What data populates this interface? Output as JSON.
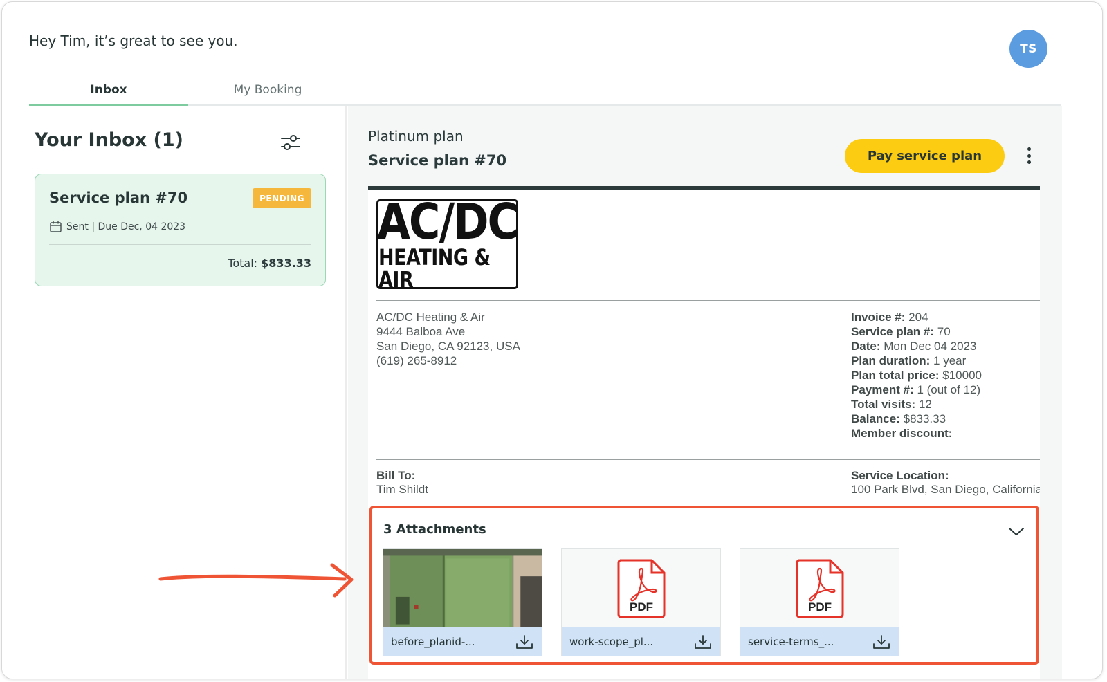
{
  "header": {
    "greeting": "Hey Tim, it’s great to see you.",
    "avatar_initials": "TS",
    "avatar_color": "#5b9be0"
  },
  "tabs": [
    {
      "label": "Inbox",
      "active": true
    },
    {
      "label": "My Booking",
      "active": false
    }
  ],
  "inbox": {
    "title": "Your Inbox (1)",
    "filter_icon": "sliders-icon",
    "cards": [
      {
        "title": "Service plan #70",
        "badge": "PENDING",
        "meta": "Sent | Due Dec, 04 2023",
        "total_label": "Total:",
        "total_value": "$833.33"
      }
    ]
  },
  "plan": {
    "name": "Platinum plan",
    "title": "Service plan #70",
    "pay_button": "Pay service plan",
    "accent_color": "#fccc12"
  },
  "invoice_doc": {
    "logo_line1": "AC/DC",
    "logo_line2": "HEATING & AIR",
    "company_lines": [
      "AC/DC Heating & Air",
      "9444 Balboa Ave",
      "San Diego, CA 92123, USA",
      "(619) 265-8912"
    ],
    "details": [
      {
        "label": "Invoice #:",
        "value": "204"
      },
      {
        "label": "Service plan #:",
        "value": "70"
      },
      {
        "label": "Date:",
        "value": "Mon Dec 04 2023"
      },
      {
        "label": "Plan duration:",
        "value": "1 year"
      },
      {
        "label": "Plan total price:",
        "value": "$10000"
      },
      {
        "label": "Payment #:",
        "value": "1 (out of 12)"
      },
      {
        "label": "Total visits:",
        "value": "12"
      },
      {
        "label": "Balance:",
        "value": "$833.33"
      },
      {
        "label": "Member discount:",
        "value": ""
      }
    ],
    "bill_to_label": "Bill To:",
    "bill_to_name": "Tim Shildt",
    "service_location_label": "Service Location:",
    "service_location_value": "100 Park Blvd, San Diego, California"
  },
  "attachments": {
    "title": "3 Attachments",
    "highlight_color": "#ef5535",
    "items": [
      {
        "name": "before_planid-...",
        "type": "image"
      },
      {
        "name": "work-scope_pl...",
        "type": "pdf",
        "icon_text": "PDF"
      },
      {
        "name": "service-terms_...",
        "type": "pdf",
        "icon_text": "PDF"
      }
    ]
  }
}
